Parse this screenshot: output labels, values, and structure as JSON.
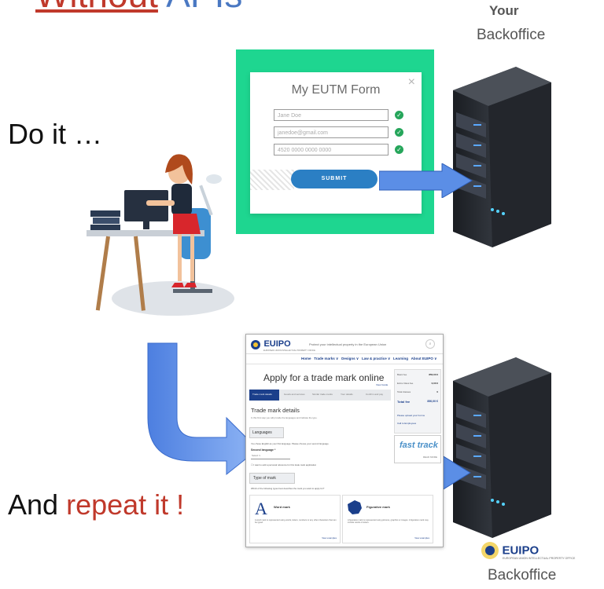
{
  "title": {
    "word1": "Without",
    "word2": "APIs"
  },
  "labels": {
    "your": "Your",
    "backoffice_top": "Backoffice",
    "do_it": "Do it …",
    "and": "And",
    "repeat": "repeat it !",
    "backoffice_bottom": "Backoffice"
  },
  "form": {
    "title": "My EUTM Form",
    "close": "×",
    "fields": [
      "Jane Doe",
      "janedoe@gmail.com",
      "4520 0000 0000 0000"
    ],
    "submit_label": "SUBMIT"
  },
  "euipo_page": {
    "logo": "EUIPO",
    "logo_sub": "EUROPEAN UNION INTELLECTUAL PROPERTY OFFICE",
    "tagline": "Protect your intellectual property in the European Union",
    "nav": [
      "Home",
      "Trade marks ∨",
      "Designs ∨",
      "Law & practice ∨",
      "Learning",
      "About EUIPO ∨"
    ],
    "heading": "Apply for a trade mark online",
    "view_guide": "View Guide",
    "steps": [
      "Trade mark details",
      "Goods and services",
      "Similar trade marks",
      "Your details",
      "Confirm and pay"
    ],
    "fees": [
      {
        "label": "Basic fee",
        "value": "850,00 €"
      },
      {
        "label": "Extra Class fee",
        "value": "0,00 €"
      },
      {
        "label": "Total classes",
        "value": "0"
      },
      {
        "label": "Total fee",
        "value": "850,00 €"
      }
    ],
    "side_links": [
      "Please upload your Forms",
      "Call to Employees"
    ],
    "fasttrack": "fast track",
    "fasttrack_more": "READ MORE",
    "section_title": "Trade mark details",
    "section_desc": "In this first step you will provide the languages and indicate the type.",
    "languages_label": "Languages",
    "lang_text": "You chose English as your first language. Please choose your second language.",
    "second_language": "Second language *",
    "select_value": "Select ∨",
    "reference_text": "I want to add a personal reference for this trade mark application",
    "type_label": "Type of mark",
    "type_question": "Which of the following types best describes the mark you want to apply for?",
    "marks": [
      {
        "letter": "A",
        "title": "Word mark",
        "desc": "A word mark is represented using words, letters, numbers or any other characters that can be typed.",
        "link": "View examples"
      },
      {
        "letter": "",
        "title": "Figurative mark",
        "desc": "A figurative mark is represented using pictures, graphics or images. A figurative mark may include words or letters.",
        "link": "View examples"
      }
    ]
  },
  "colors": {
    "accent_red": "#c0392b",
    "accent_blue": "#4a78c2",
    "form_green": "#1ed690",
    "submit_blue": "#2b7fc4",
    "arrow_blue": "#5b8ee6"
  }
}
